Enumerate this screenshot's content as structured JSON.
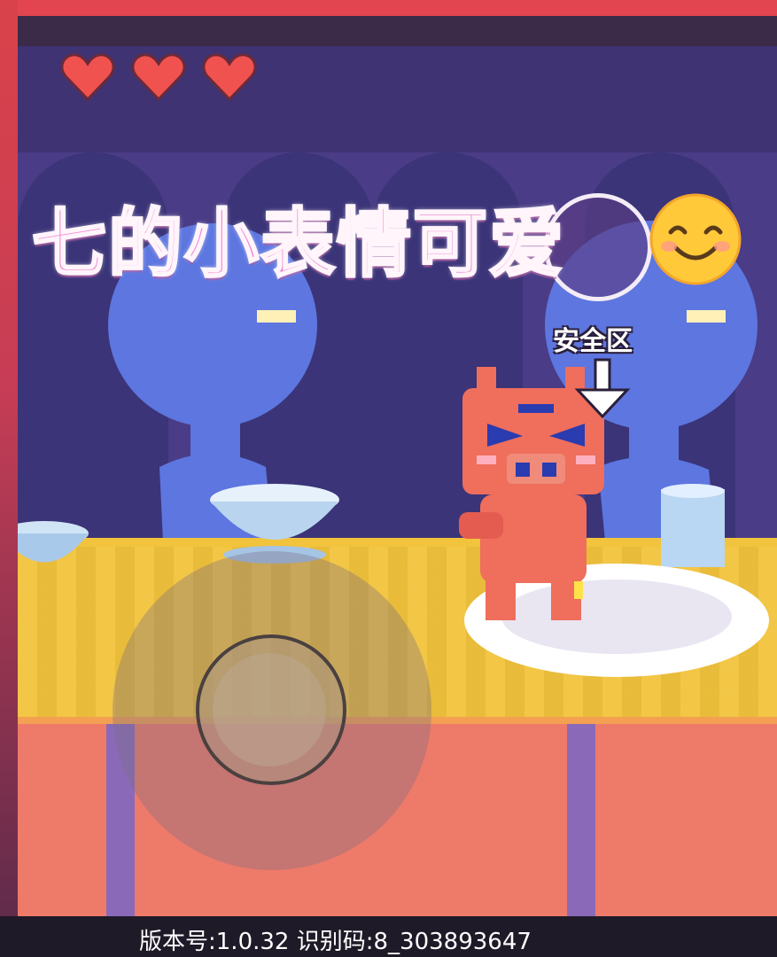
{
  "hud": {
    "lives": 3,
    "heart_icon": "heart-icon",
    "heart_color": "#f0524f"
  },
  "overlay": {
    "caption": "七的小表情可爱",
    "caption_emoji": "smiling-face-icon"
  },
  "skill": {
    "safe_zone_label": "安全区",
    "arrow_icon": "arrow-down-icon"
  },
  "footer": {
    "version_text": "版本号:1.0.32 识别码:8_303893647"
  },
  "colors": {
    "wall": "#4a3c86",
    "table_top": "#f2c33c",
    "table_front": "#ee7a6a",
    "character": "#ef6e5c",
    "npc": "#5d76e0"
  }
}
